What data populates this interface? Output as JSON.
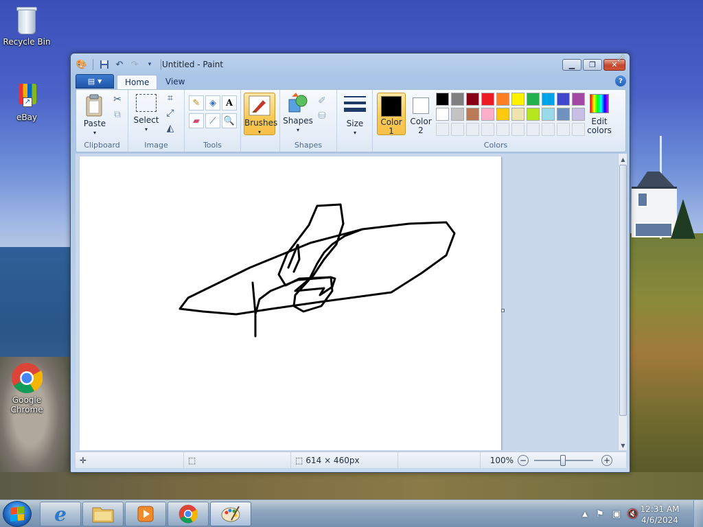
{
  "desktop": {
    "icons": [
      {
        "label": "Recycle Bin"
      },
      {
        "label": "eBay"
      },
      {
        "label": "Google Chrome"
      }
    ]
  },
  "window": {
    "title": "Untitled - Paint",
    "tabs": {
      "home": "Home",
      "view": "View"
    },
    "ribbon": {
      "clipboard": {
        "label": "Clipboard",
        "paste": "Paste"
      },
      "image": {
        "label": "Image",
        "select": "Select"
      },
      "tools": {
        "label": "Tools"
      },
      "brushes": {
        "label": "Brushes"
      },
      "shapes": {
        "label": "Shapes",
        "shapes_btn": "Shapes"
      },
      "size": {
        "label": "Size"
      },
      "colors": {
        "label": "Colors",
        "color1_line1": "Color",
        "color1_line2": "1",
        "color2_line1": "Color",
        "color2_line2": "2",
        "edit_line1": "Edit",
        "edit_line2": "colors",
        "color1_value": "#000000",
        "color2_value": "#ffffff",
        "row1": [
          "#000000",
          "#7f7f7f",
          "#880015",
          "#ed1c24",
          "#ff7f27",
          "#fff200",
          "#22b14c",
          "#00a2e8",
          "#3f48cc",
          "#a349a4"
        ],
        "row2": [
          "#ffffff",
          "#c3c3c3",
          "#b97a57",
          "#ffaec9",
          "#ffc90e",
          "#efe4b0",
          "#b5e61d",
          "#99d9ea",
          "#7092be",
          "#c8bfe7"
        ]
      }
    },
    "status": {
      "dimensions": "614 × 460px",
      "zoom": "100%"
    }
  },
  "taskbar": {
    "time": "12:31 AM",
    "date": "4/6/2024"
  }
}
